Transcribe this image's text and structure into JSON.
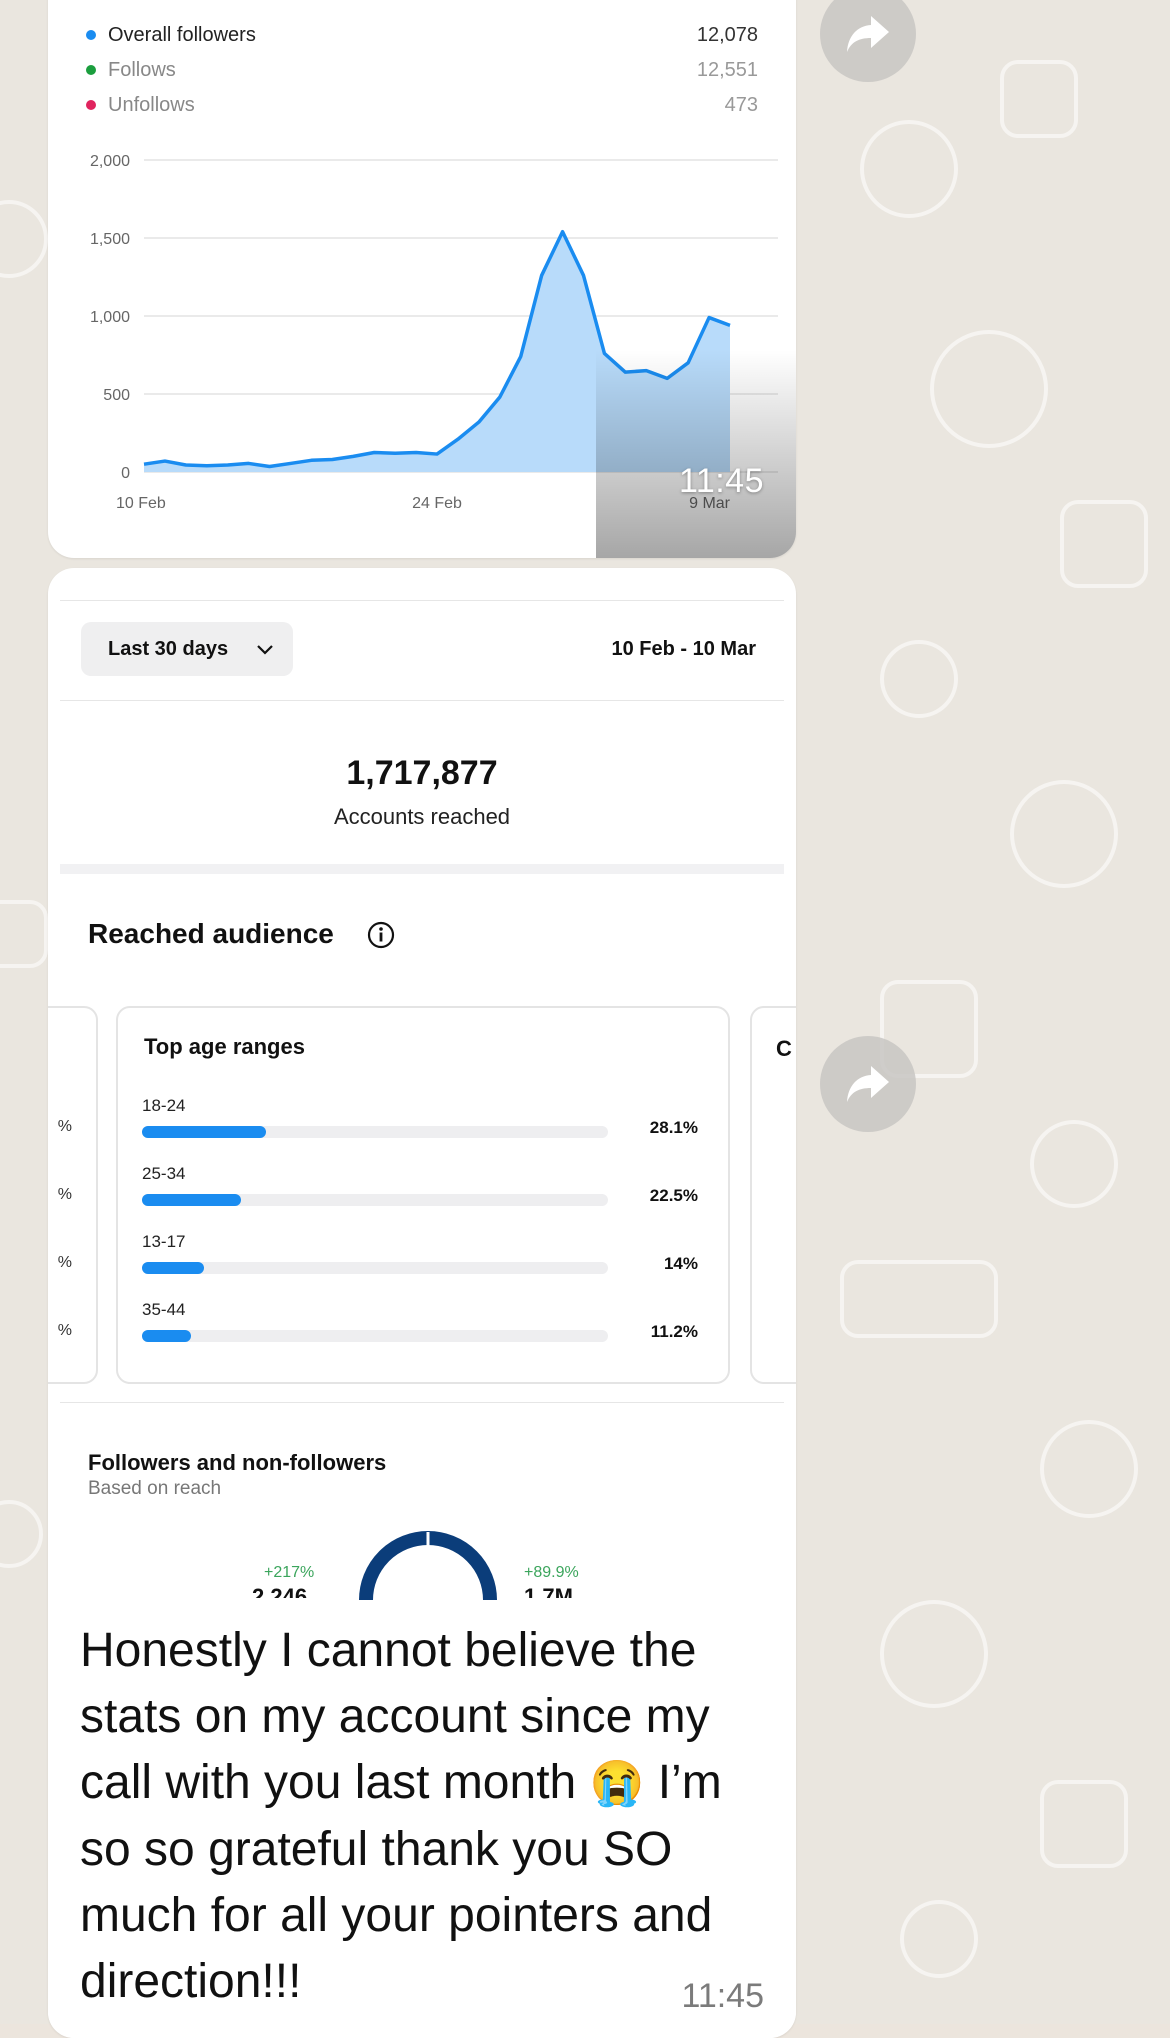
{
  "chart_card": {
    "legend": [
      {
        "label": "Overall followers",
        "value": "12,078",
        "color": "#1A8CF0"
      },
      {
        "label": "Follows",
        "value": "12,551",
        "color": "#1B9E3E"
      },
      {
        "label": "Unfollows",
        "value": "473",
        "color": "#E0245E"
      }
    ],
    "timestamp": "11:45"
  },
  "chart_data": {
    "type": "area",
    "x_tick_labels": [
      "10 Feb",
      "24 Feb",
      "9 Mar"
    ],
    "y_tick_labels": [
      "0",
      "500",
      "1,000",
      "1,500",
      "2,000"
    ],
    "ylim": [
      0,
      2000
    ],
    "grid": true,
    "color": "#1A8CF0",
    "fill_color": "#B8DBFA",
    "series": [
      {
        "values": [
          50,
          70,
          45,
          40,
          45,
          55,
          35,
          55,
          75,
          80,
          100,
          125,
          120,
          125,
          115,
          210,
          320,
          480,
          740,
          1260,
          1540,
          1260,
          760,
          640,
          650,
          600,
          700,
          990,
          940
        ]
      }
    ]
  },
  "reach_card": {
    "range_label": "Last 30 days",
    "date_range": "10 Feb - 10 Mar",
    "accounts_reached_value": "1,717,877",
    "accounts_reached_label": "Accounts reached",
    "reached_audience_title": "Reached audience",
    "age_card_title": "Top age ranges",
    "age_ranges": [
      {
        "label": "18-24",
        "pct": "28.1%",
        "fraction": 0.281
      },
      {
        "label": "25-34",
        "pct": "22.5%",
        "fraction": 0.225
      },
      {
        "label": "13-17",
        "pct": "14%",
        "fraction": 0.14
      },
      {
        "label": "35-44",
        "pct": "11.2%",
        "fraction": 0.112
      }
    ],
    "followers_title": "Followers and non-followers",
    "followers_subtitle": "Based on reach",
    "left_change": "+217%",
    "left_value": "2,246",
    "right_change": "+89.9%",
    "right_value": "1.7M"
  },
  "message": {
    "text_line1": "Honestly I cannot believe the stats on my account since my call with you last month",
    "emoji": "😭",
    "text_line2": "I’m so so grateful thank you SO much for all your pointers and direction!!!",
    "time": "11:45"
  },
  "colors": {
    "accent_blue": "#1A8CF0",
    "donut_navy": "#0B3D7A",
    "positive_green": "#3BA55C",
    "wallpaper": "#EAE6DF"
  }
}
